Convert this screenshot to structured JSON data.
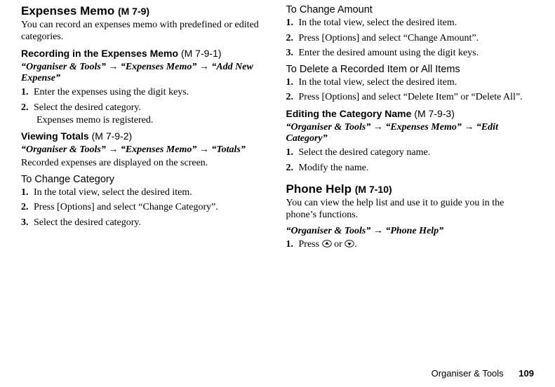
{
  "left": {
    "h1": "Expenses Memo",
    "h1_code": "(M 7-9)",
    "intro": "You can record an expenses memo with predefined or edited categories.",
    "rec": {
      "title": "Recording in the Expenses Memo",
      "code": "(M 7-9-1)",
      "path_a": "“Organiser & Tools”",
      "path_b": "“Expenses Memo”",
      "path_c": "“Add New Expense”",
      "s1": "Enter the expenses using the digit keys.",
      "s2": "Select the desired category.",
      "s2_sub": "Expenses memo is registered."
    },
    "view": {
      "title": "Viewing Totals",
      "code": "(M 7-9-2)",
      "path_a": "“Organiser & Tools”",
      "path_b": "“Expenses Memo”",
      "path_c": "“Totals”",
      "desc": "Recorded expenses are displayed on the screen."
    },
    "chcat": {
      "title": "To Change Category",
      "s1": "In the total view, select the desired item.",
      "s2": "Press [Options] and select “Change Category”.",
      "s3": "Select the desired category."
    }
  },
  "right": {
    "chamt": {
      "title": "To Change Amount",
      "s1": "In the total view, select the desired item.",
      "s2": "Press [Options] and select “Change Amount”.",
      "s3": "Enter the desired amount using the digit keys."
    },
    "del": {
      "title": "To Delete a Recorded Item or All Items",
      "s1": "In the total view, select the desired item.",
      "s2": "Press [Options] and select “Delete Item” or “Delete All”."
    },
    "edit": {
      "title": "Editing the Category Name",
      "code": "(M 7-9-3)",
      "path_a": "“Organiser & Tools”",
      "path_b": "“Expenses Memo”",
      "path_c": "“Edit Category”",
      "s1": "Select the desired category name.",
      "s2": "Modify the name."
    },
    "help": {
      "h1": "Phone Help",
      "h1_code": "(M 7-10)",
      "intro": "You can view the help list and use it to guide you in the phone’s functions.",
      "path_a": "“Organiser & Tools”",
      "path_b": "“Phone Help”",
      "s1_a": "Press ",
      "s1_b": " or ",
      "s1_c": "."
    }
  },
  "footer": {
    "section": "Organiser & Tools",
    "page": "109"
  },
  "arrow": "→"
}
